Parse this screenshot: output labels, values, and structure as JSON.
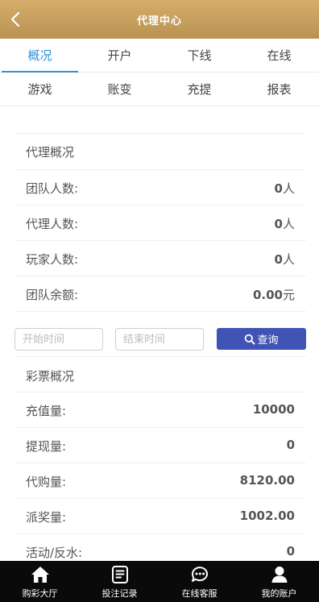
{
  "header": {
    "title": "代理中心"
  },
  "tabs": {
    "row1": [
      "概况",
      "开户",
      "下线",
      "在线"
    ],
    "row2": [
      "游戏",
      "账变",
      "充提",
      "报表"
    ]
  },
  "agent_overview": {
    "title": "代理概况",
    "rows": [
      {
        "label": "团队人数:",
        "value": "0",
        "unit": "人"
      },
      {
        "label": "代理人数:",
        "value": "0",
        "unit": "人"
      },
      {
        "label": "玩家人数:",
        "value": "0",
        "unit": "人"
      },
      {
        "label": "团队余额:",
        "value": "0.00",
        "unit": "元"
      }
    ]
  },
  "filter": {
    "start_placeholder": "开始时间",
    "end_placeholder": "结束时间",
    "query_label": "查询"
  },
  "lottery_overview": {
    "title": "彩票概况",
    "rows": [
      {
        "label": "充值量:",
        "value": "10000"
      },
      {
        "label": "提现量:",
        "value": "0"
      },
      {
        "label": "代购量:",
        "value": "8120.00"
      },
      {
        "label": "派奖量:",
        "value": "1002.00"
      },
      {
        "label": "活动/反水:",
        "value": "0"
      }
    ]
  },
  "bottom_nav": {
    "items": [
      {
        "label": "购彩大厅",
        "icon": "home-icon"
      },
      {
        "label": "投注记录",
        "icon": "document-icon"
      },
      {
        "label": "在线客服",
        "icon": "chat-icon"
      },
      {
        "label": "我的账户",
        "icon": "user-icon"
      }
    ]
  }
}
